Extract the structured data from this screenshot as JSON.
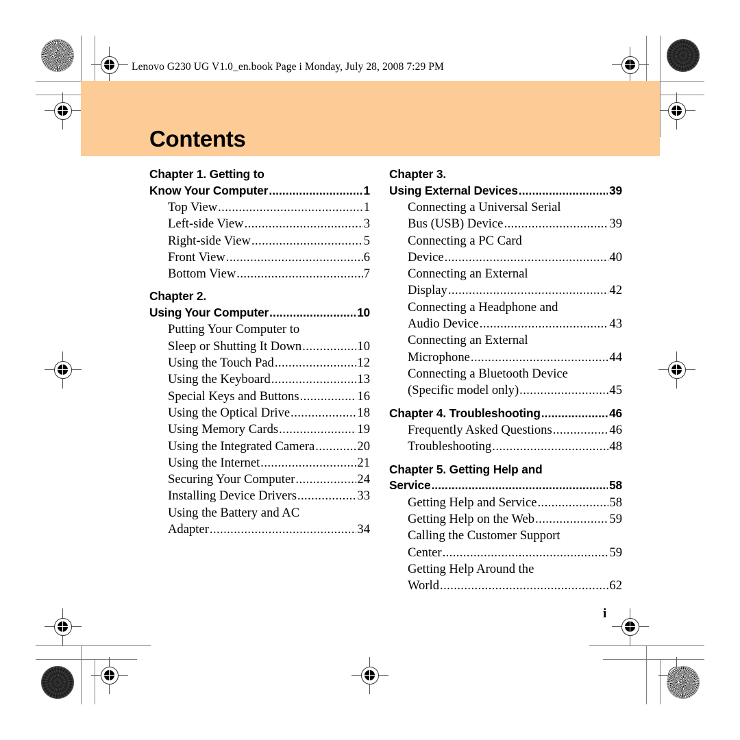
{
  "header": {
    "slug": "Lenovo G230 UG V1.0_en.book  Page i  Monday, July 28, 2008  7:29 PM"
  },
  "banner": {
    "title": "Contents",
    "background_color": "#fdcb95"
  },
  "folio": {
    "page_number": "i"
  },
  "marks": {
    "registration_icon": "registration-target-icon",
    "starburst_icon": "starburst-rosette-icon",
    "density_icon": "density-patch-icon"
  },
  "toc": {
    "columns": [
      {
        "id": "left",
        "blocks": [
          {
            "type": "chapter",
            "line1": "Chapter 1. Getting to",
            "line2": "Know Your Computer",
            "page": "1",
            "entries": [
              {
                "lines": [
                  "Top View"
                ],
                "page": "1"
              },
              {
                "lines": [
                  "Left-side View"
                ],
                "page": "3"
              },
              {
                "lines": [
                  "Right-side View"
                ],
                "page": "5"
              },
              {
                "lines": [
                  "Front View"
                ],
                "page": "6"
              },
              {
                "lines": [
                  "Bottom View"
                ],
                "page": "7"
              }
            ]
          },
          {
            "type": "chapter",
            "line1": "Chapter 2.",
            "line2": "Using Your Computer",
            "page": "10",
            "entries": [
              {
                "lines": [
                  "Putting Your Computer to",
                  "Sleep or Shutting It Down"
                ],
                "page": "10"
              },
              {
                "lines": [
                  "Using the Touch Pad"
                ],
                "page": "12"
              },
              {
                "lines": [
                  "Using the Keyboard"
                ],
                "page": "13"
              },
              {
                "lines": [
                  "Special Keys and Buttons"
                ],
                "page": "16"
              },
              {
                "lines": [
                  "Using the Optical Drive"
                ],
                "page": "18"
              },
              {
                "lines": [
                  "Using Memory Cards"
                ],
                "page": "19"
              },
              {
                "lines": [
                  "Using the Integrated Camera"
                ],
                "page": "20"
              },
              {
                "lines": [
                  "Using the Internet"
                ],
                "page": "21"
              },
              {
                "lines": [
                  "Securing Your Computer"
                ],
                "page": "24"
              },
              {
                "lines": [
                  "Installing Device Drivers"
                ],
                "page": "33"
              },
              {
                "lines": [
                  "Using the Battery and AC",
                  "Adapter"
                ],
                "page": "34"
              }
            ]
          }
        ]
      },
      {
        "id": "right",
        "blocks": [
          {
            "type": "chapter",
            "line1": "Chapter 3.",
            "line2": "Using External Devices",
            "page": "39",
            "entries": [
              {
                "lines": [
                  "Connecting a Universal Serial",
                  "Bus (USB) Device"
                ],
                "page": "39"
              },
              {
                "lines": [
                  "Connecting a PC Card",
                  "Device"
                ],
                "page": "40"
              },
              {
                "lines": [
                  "Connecting an External",
                  "Display"
                ],
                "page": "42"
              },
              {
                "lines": [
                  "Connecting a Headphone and",
                  "Audio Device"
                ],
                "page": "43"
              },
              {
                "lines": [
                  "Connecting an External",
                  " Microphone"
                ],
                "page": "44"
              },
              {
                "lines": [
                  "Connecting a Bluetooth Device",
                  "(Specific model only)"
                ],
                "page": "45"
              }
            ]
          },
          {
            "type": "chapter",
            "line1": "",
            "line2": "Chapter 4. Troubleshooting",
            "page": "46",
            "entries": [
              {
                "lines": [
                  "Frequently Asked Questions"
                ],
                "page": "46"
              },
              {
                "lines": [
                  "Troubleshooting"
                ],
                "page": "48"
              }
            ]
          },
          {
            "type": "chapter",
            "line1": "Chapter 5. Getting Help and",
            "line2": "Service",
            "page": "58",
            "entries": [
              {
                "lines": [
                  "Getting Help and Service"
                ],
                "page": "58"
              },
              {
                "lines": [
                  "Getting Help on the Web"
                ],
                "page": "59"
              },
              {
                "lines": [
                  "Calling the Customer Support",
                  "Center"
                ],
                "page": "59"
              },
              {
                "lines": [
                  "Getting Help Around the",
                  "World"
                ],
                "page": "62"
              }
            ]
          }
        ]
      }
    ]
  }
}
